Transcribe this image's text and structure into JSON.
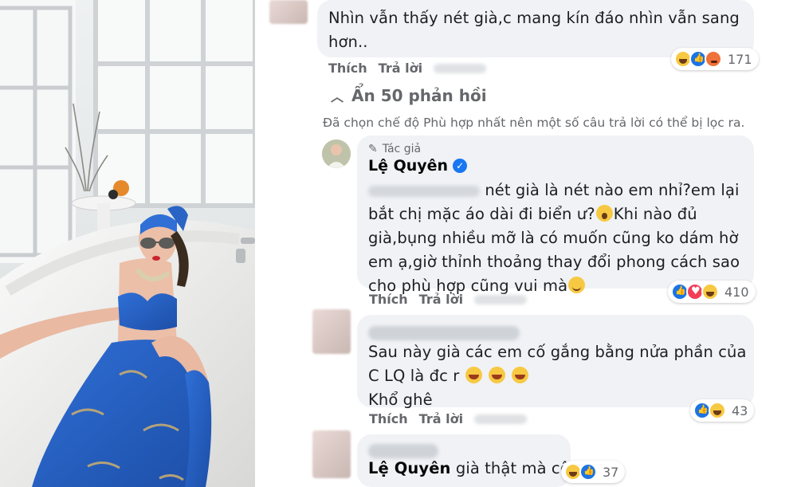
{
  "comment1": {
    "text_line1": "Nhìn vẫn thấy nét già,c mang kín đáo nhìn vẫn sang",
    "text_line2": "hơn..",
    "like_label": "Thích",
    "reply_label": "Trả lời",
    "reaction_count": "171",
    "reactions": [
      "haha-icon",
      "like-icon",
      "angry-icon"
    ]
  },
  "hide_replies_label": "Ẩn 50 phản hồi",
  "filter_note": "Đã chọn chế độ Phù hợp nhất nên một số câu trả lời có thể bị lọc ra.",
  "comment2": {
    "badge": "Tác giả",
    "author": "Lệ Quyên",
    "line1": "nét già là nét nào em nhỉ?em lại",
    "line2a": "bắt chị mặc áo dài đi biển ư?",
    "line2b": "Khi nào đủ",
    "line3": "già,bụng nhiều mỡ là có muốn cũng ko dám hờ",
    "line4": "em ạ,giờ thỉnh thoảng thay đổi phong cách sao",
    "line5": "cho phù hợp cũng vui mà",
    "like_label": "Thích",
    "reply_label": "Trả lời",
    "reaction_count": "410",
    "reactions": [
      "like-icon",
      "love-icon",
      "haha-icon"
    ]
  },
  "comment3": {
    "line1": "Sau này già các em cố gắng bằng nửa phần của",
    "line2": "C LQ là đc r",
    "line3": "Khổ ghê",
    "like_label": "Thích",
    "reply_label": "Trả lời",
    "reaction_count": "43",
    "reactions": [
      "like-icon",
      "haha-icon"
    ]
  },
  "comment4": {
    "tag": "Lệ Quyên",
    "text": "già thật mà cô",
    "reaction_count": "37",
    "reactions": [
      "haha-icon",
      "like-icon"
    ]
  },
  "colors": {
    "bubble": "#f0f2f5",
    "secondary_text": "#65676b",
    "verified_blue": "#1877f2"
  }
}
